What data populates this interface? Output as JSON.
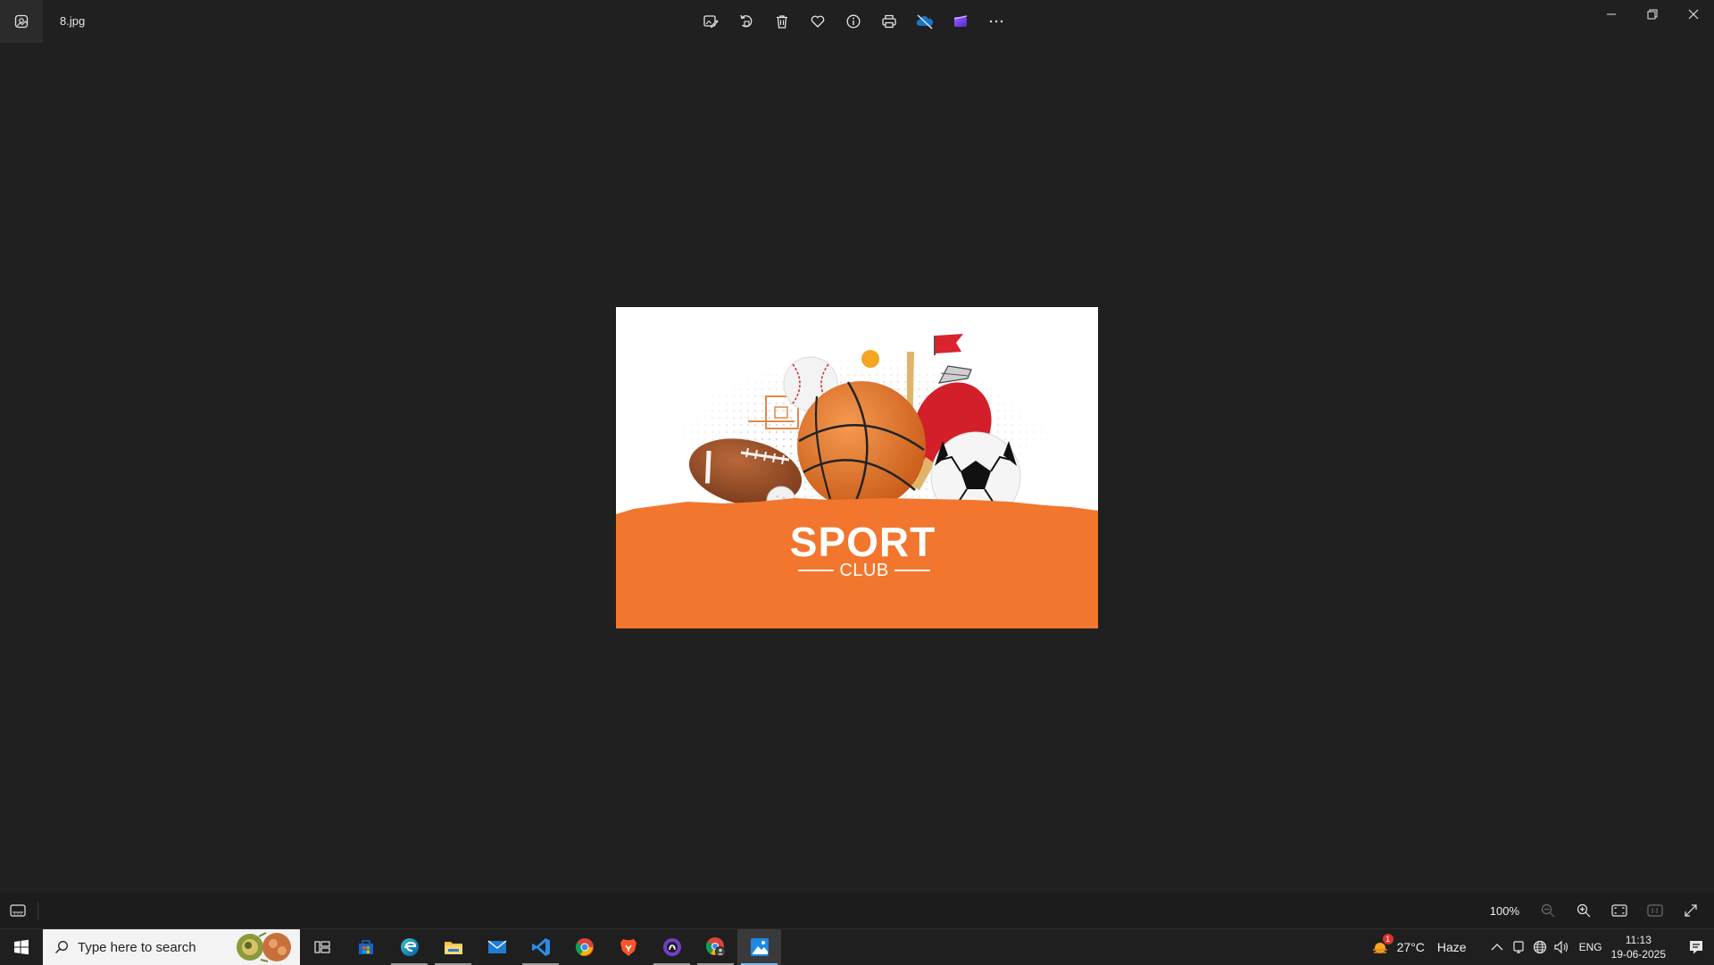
{
  "title_bar": {
    "app_icon": "photos-app-icon",
    "filename": "8.jpg",
    "toolbar": [
      {
        "name": "edit-image-button",
        "icon": "edit-image-icon"
      },
      {
        "name": "rotate-button",
        "icon": "rotate-icon"
      },
      {
        "name": "delete-button",
        "icon": "trash-icon"
      },
      {
        "name": "favorite-button",
        "icon": "heart-icon"
      },
      {
        "name": "file-info-button",
        "icon": "info-icon"
      },
      {
        "name": "print-button",
        "icon": "printer-icon"
      },
      {
        "name": "onedrive-button",
        "icon": "cloud-off-icon"
      },
      {
        "name": "clipchamp-button",
        "icon": "clipchamp-icon"
      },
      {
        "name": "more-options-button",
        "icon": "ellipsis-icon"
      }
    ],
    "window_controls": [
      "minimize",
      "restore",
      "close"
    ]
  },
  "image": {
    "headline": "SPORT",
    "subline": "CLUB",
    "colors": {
      "orange": "#f2762e",
      "white": "#ffffff"
    }
  },
  "bottom_bar": {
    "zoom_level": "100%"
  },
  "taskbar": {
    "search_placeholder": "Type here to search",
    "apps": [
      {
        "name": "task-view",
        "running": false,
        "active": false
      },
      {
        "name": "microsoft-store",
        "running": false,
        "active": false
      },
      {
        "name": "edge",
        "running": true,
        "active": false
      },
      {
        "name": "file-explorer",
        "running": true,
        "active": false
      },
      {
        "name": "mail",
        "running": false,
        "active": false
      },
      {
        "name": "vscode",
        "running": true,
        "active": false
      },
      {
        "name": "chrome",
        "running": false,
        "active": false
      },
      {
        "name": "brave",
        "running": false,
        "active": false
      },
      {
        "name": "github-desktop",
        "running": true,
        "active": false
      },
      {
        "name": "chrome-profile",
        "running": true,
        "active": false
      },
      {
        "name": "photos",
        "running": true,
        "active": true
      }
    ],
    "weather": {
      "temperature": "27°C",
      "condition": "Haze",
      "alert_count": "1"
    },
    "language": "ENG",
    "time": "11:13",
    "date": "19-06-2025"
  }
}
